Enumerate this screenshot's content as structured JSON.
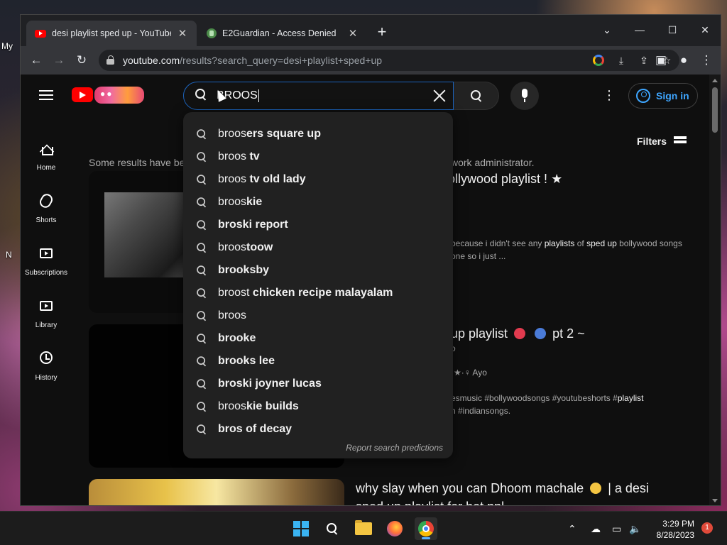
{
  "desktop": {
    "label_top": "My",
    "label_mid": "N"
  },
  "browser": {
    "tabs": [
      {
        "title": "desi playlist sped up - YouTube",
        "active": true
      },
      {
        "title": "E2Guardian - Access Denied",
        "active": false
      }
    ],
    "url_host": "youtube.com",
    "url_rest": "/results?search_query=desi+playlist+sped+up"
  },
  "youtube": {
    "search_query": "BROOS",
    "sign_in_label": "Sign in",
    "filters_label": "Filters",
    "guide": [
      {
        "label": "Home",
        "icon": "home-icon"
      },
      {
        "label": "Shorts",
        "icon": "shorts-icon"
      },
      {
        "label": "Subscriptions",
        "icon": "subscriptions-icon"
      },
      {
        "label": "Library",
        "icon": "library-icon"
      },
      {
        "label": "History",
        "icon": "history-icon"
      }
    ],
    "notice_start": "Some results have be",
    "notice_end": "work administrator.",
    "suggestions": [
      {
        "typed": "broos",
        "completion": "ers square up"
      },
      {
        "typed": "broos",
        "completion": " tv"
      },
      {
        "typed": "broos",
        "completion": " tv old lady"
      },
      {
        "typed": "broos",
        "completion": "kie"
      },
      {
        "typed": "",
        "completion": "broski report"
      },
      {
        "typed": "broos",
        "completion": "toow"
      },
      {
        "typed": "",
        "completion": "brooksby"
      },
      {
        "typed": "broost",
        "completion": " chicken recipe malayalam"
      },
      {
        "typed": "broos",
        "completion": ""
      },
      {
        "typed": "",
        "completion": "brooke"
      },
      {
        "typed": "",
        "completion": "brooks lee"
      },
      {
        "typed": "",
        "completion": "broski joyner lucas"
      },
      {
        "typed": "broos",
        "completion": "kie builds"
      },
      {
        "typed": "",
        "completion": "bros of decay"
      }
    ],
    "report_predictions": "Report search predictions",
    "videos": [
      {
        "title_visible": "ollywood playlist ! ★",
        "desc_line1_pre": "because i didn't see any ",
        "desc_line1_b1": "playlists",
        "desc_line1_mid": " of ",
        "desc_line1_b2": "sped up",
        "desc_line1_post": " bollywood songs",
        "desc_line2": "one so i just ..."
      },
      {
        "title_visible": "up playlist",
        "title_tail": "pt 2 ~",
        "meta1": "o",
        "channel": "·★·♀ Ayo",
        "desc_line1_pre": "esmusic #bollywoodsongs #youtubeshorts #",
        "desc_line1_b1": "playlist",
        "desc_line2": "n #indiansongs."
      },
      {
        "title_line1": "why slay when you can Dhoom machale",
        "title_line1_tail": "| a desi",
        "title_line2": "sped up playlist for hot ppl"
      }
    ]
  },
  "taskbar": {
    "time": "3:29 PM",
    "date": "8/28/2023",
    "notification_count": "1"
  }
}
